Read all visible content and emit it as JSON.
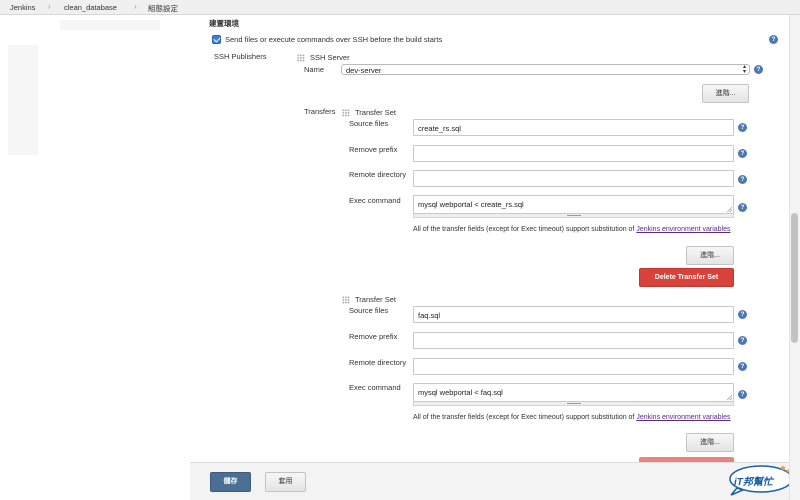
{
  "breadcrumb": {
    "items": [
      "Jenkins",
      "clean_database",
      "組態設定"
    ],
    "separator": "›"
  },
  "build_env": {
    "heading": "建置環境",
    "ssh_checkbox_label": "Send files or execute commands over SSH before the build starts",
    "ssh_checkbox_checked": true
  },
  "ssh": {
    "publishers_label": "SSH Publishers",
    "server_heading": "SSH Server",
    "name_label": "Name",
    "name_value": "dev-server",
    "advanced_label": "進階..."
  },
  "transfers": {
    "label": "Transfers",
    "sets": [
      {
        "heading": "Transfer Set",
        "source_files_label": "Source files",
        "source_files": "create_rs.sql",
        "remove_prefix_label": "Remove prefix",
        "remove_prefix": "",
        "remote_directory_label": "Remote directory",
        "remote_directory": "",
        "exec_command_label": "Exec command",
        "exec_command": "mysql webportal < create_rs.sql",
        "note_text": "All of the transfer fields (except for Exec timeout) support substitution of ",
        "note_link": "Jenkins environment variables",
        "advanced_label": "進階...",
        "delete_label": "Delete Transfer Set"
      },
      {
        "heading": "Transfer Set",
        "source_files_label": "Source files",
        "source_files": "faq.sql",
        "remove_prefix_label": "Remove prefix",
        "remove_prefix": "",
        "remote_directory_label": "Remote directory",
        "remote_directory": "",
        "exec_command_label": "Exec command",
        "exec_command": "mysql webportal < faq.sql",
        "note_text": "All of the transfer fields (except for Exec timeout) support substitution of ",
        "note_link": "Jenkins environment variables",
        "advanced_label": "進階..."
      }
    ]
  },
  "footer": {
    "save_label": "儲存",
    "apply_label": "套用"
  },
  "help_glyph": "?",
  "watermark_text": "iT邦幫忙",
  "colors": {
    "primary_button": "#4b6f93",
    "delete_button": "#d9423a",
    "help_icon": "#4a78b0",
    "checkbox": "#3f7fcf",
    "link": "#5b2b8a"
  }
}
